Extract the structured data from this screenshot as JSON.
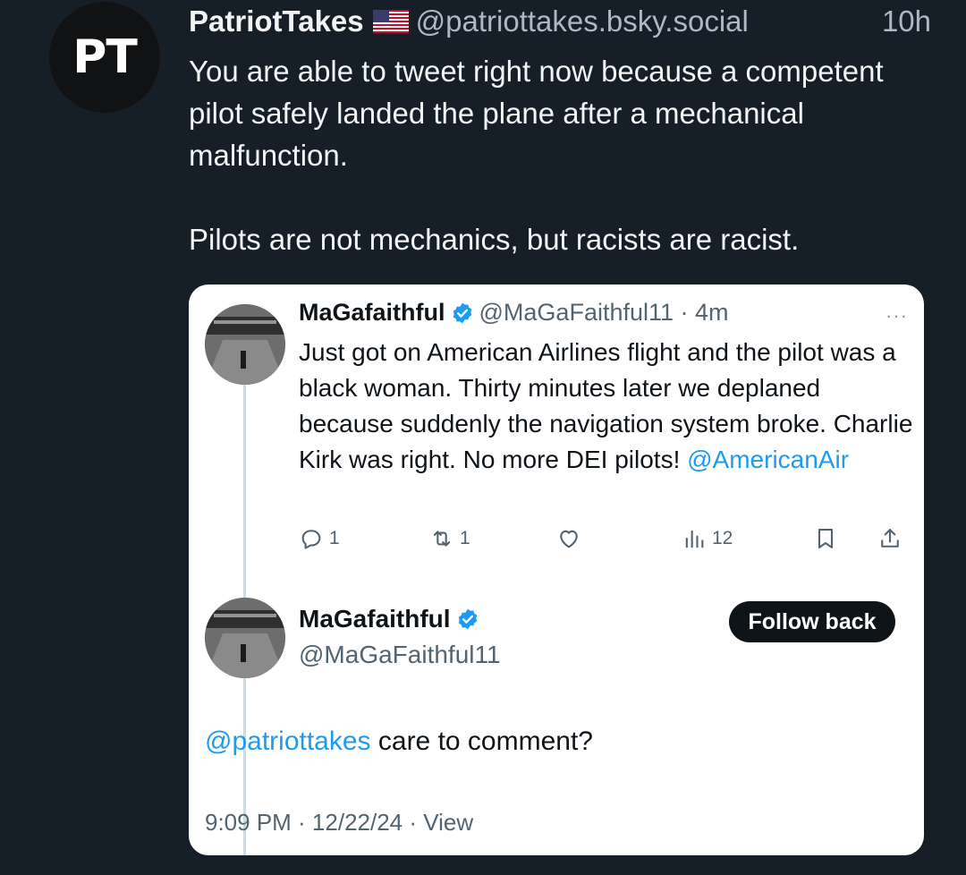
{
  "post": {
    "avatar_text": "PT",
    "author_name": "PatriotTakes",
    "author_flag_icon": "us-flag-icon",
    "handle": "@patriottakes.bsky.social",
    "time": "10h",
    "paragraph_1": "You are able to tweet right now because a competent pilot safely landed the plane after a mechanical malfunction.",
    "paragraph_2": "Pilots are not mechanics, but racists are racist."
  },
  "embedded": {
    "tweet1": {
      "name": "MaGafaithful",
      "handle_time": "@MaGaFaithful11 · 4m",
      "more": "···",
      "text": "Just got on American Airlines flight and the pilot was a black woman. Thirty minutes later we deplaned because suddenly the navigation system broke. Charlie Kirk was right. No more DEI pilots! ",
      "mention": "@AmericanAir",
      "replies": "1",
      "retweets": "1",
      "views": "12"
    },
    "tweet2": {
      "name": "MaGafaithful",
      "handle": "@MaGaFaithful11",
      "follow_label": "Follow back",
      "mention": "@patriottakes",
      "text": " care to comment?",
      "meta": "9:09 PM · 12/22/24 · View"
    }
  },
  "colors": {
    "background": "#161e27",
    "link": "#1d9bf0",
    "verified": "#1d9bf0"
  }
}
